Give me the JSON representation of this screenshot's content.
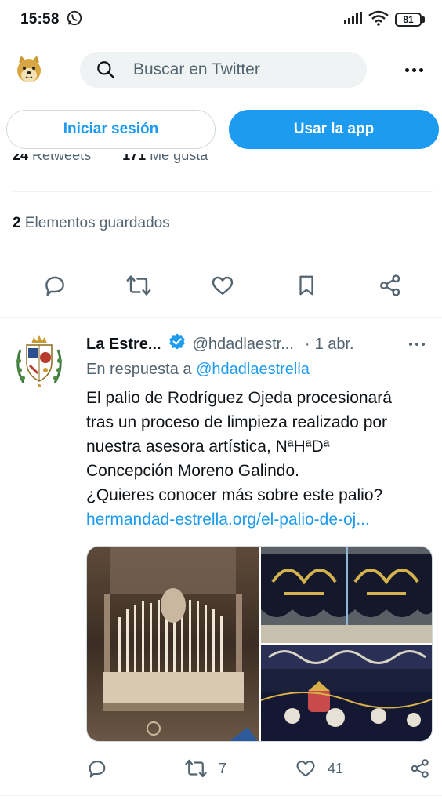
{
  "status_bar": {
    "time": "15:58",
    "battery": "81"
  },
  "header": {
    "search_placeholder": "Buscar en Twitter"
  },
  "auth": {
    "login_label": "Iniciar sesión",
    "app_label": "Usar la app"
  },
  "previous_tweet": {
    "retweets_count": "24",
    "retweets_label": "Retweets",
    "likes_count": "171",
    "likes_label": "Me gusta",
    "saved_count": "2",
    "saved_label": "Elementos guardados",
    "actions": [
      "reply-icon",
      "retweet-icon",
      "like-icon",
      "bookmark-icon",
      "share-icon"
    ]
  },
  "tweet": {
    "name": "La Estre...",
    "handle": "@hdadlaestr...",
    "separator": "·",
    "date": "1 abr.",
    "reply_prefix": "En respuesta a",
    "reply_mention": "@hdadlaestrella",
    "text_lines": [
      "El palio de Rodríguez Ojeda procesionará",
      "tras un proceso de limpieza realizado por",
      "nuestra asesora artística, NªHªDª",
      "Concepción Moreno Galindo.",
      "¿Quieres conocer más sobre este palio?"
    ],
    "link": "hermandad-estrella.org/el-palio-de-oj...",
    "retweet_count": "7",
    "like_count": "41"
  },
  "colors": {
    "accent": "#1d9bf0",
    "text": "#0f1419",
    "secondary": "#536471"
  }
}
